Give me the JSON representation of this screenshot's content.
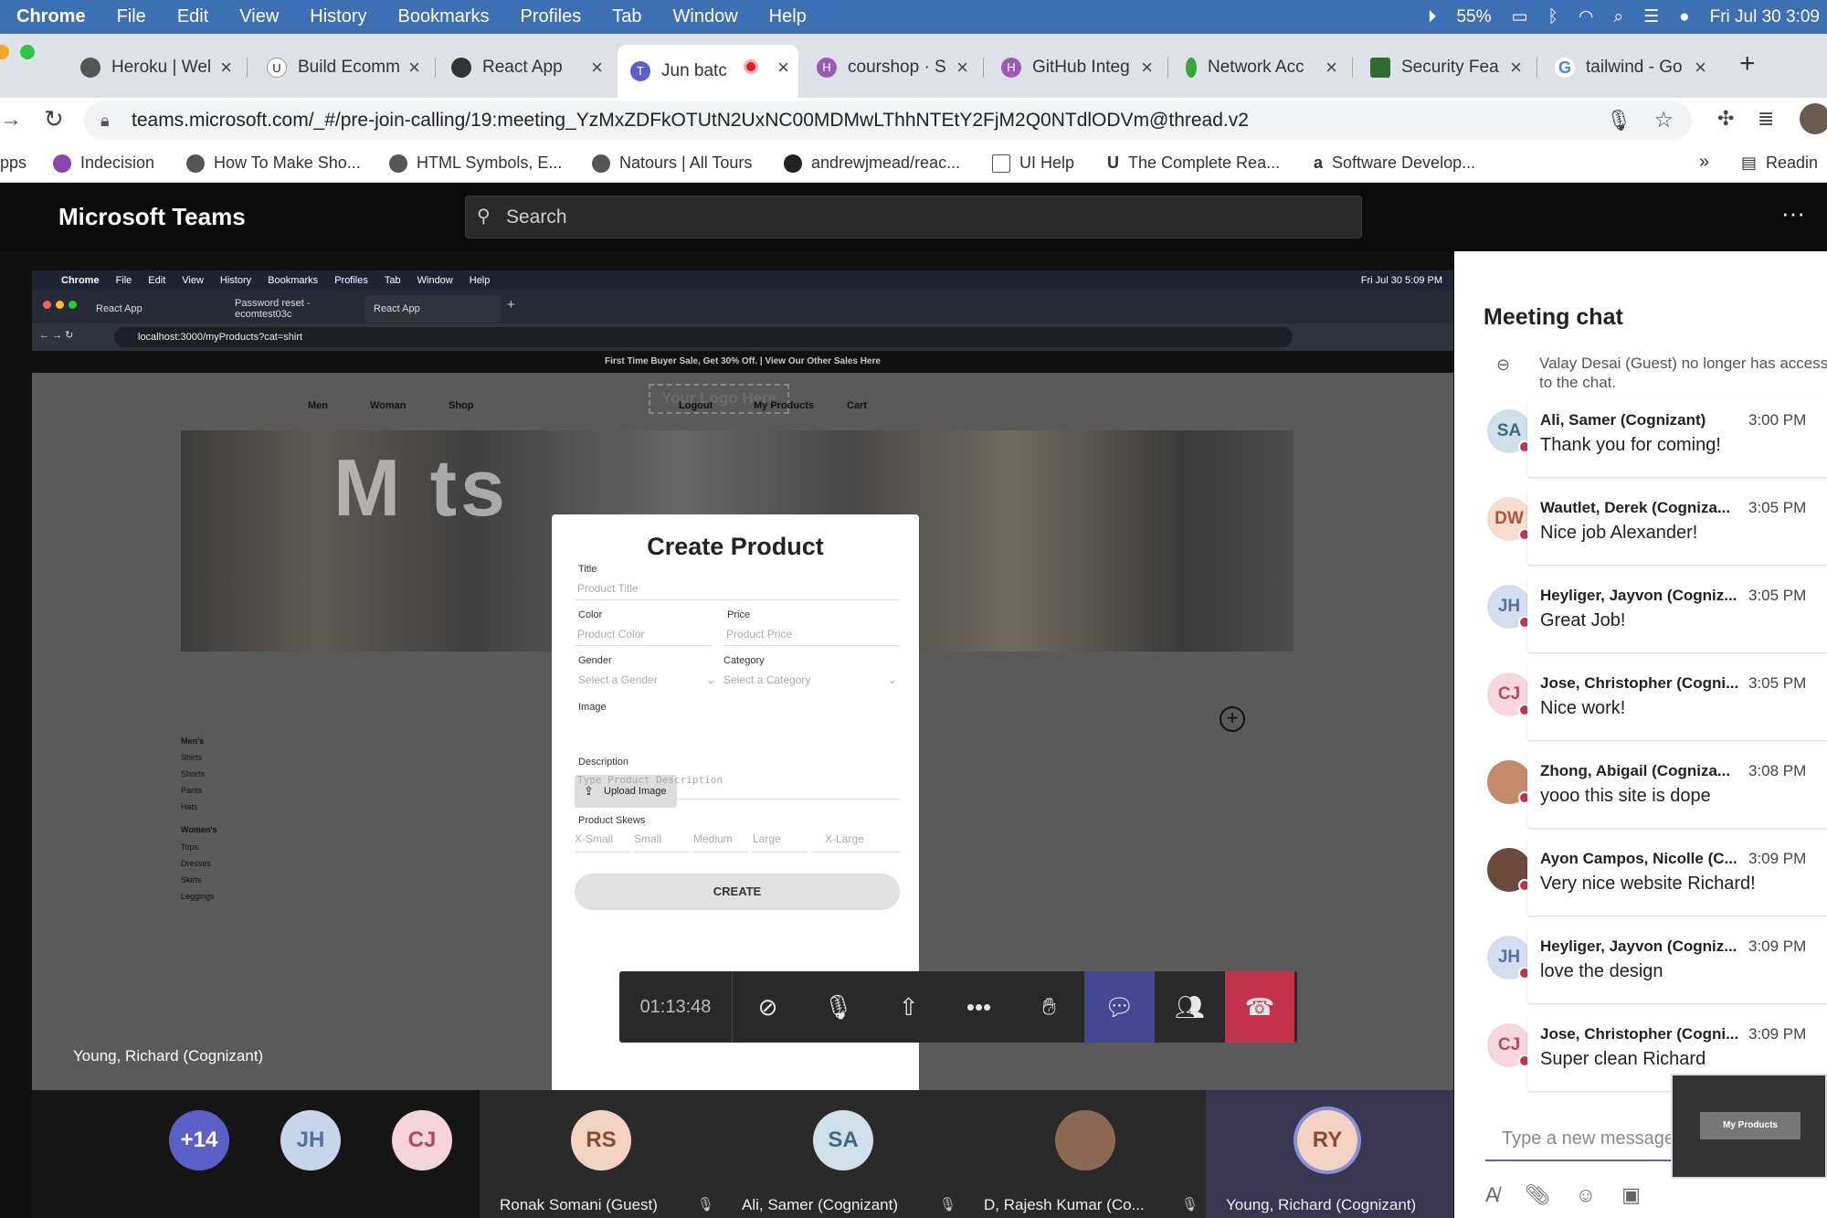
{
  "menubar": {
    "app": "Chrome",
    "items": [
      "File",
      "Edit",
      "View",
      "History",
      "Bookmarks",
      "Profiles",
      "Tab",
      "Window",
      "Help"
    ],
    "battery": "55%",
    "clock": "Fri Jul 30 3:09"
  },
  "tabs": [
    {
      "label": "Heroku | Wel"
    },
    {
      "label": "Build Ecomm"
    },
    {
      "label": "React App"
    },
    {
      "label": "Jun batc"
    },
    {
      "label": "courshop · S"
    },
    {
      "label": "GitHub Integ"
    },
    {
      "label": "Network Acc"
    },
    {
      "label": "Security Fea"
    },
    {
      "label": "tailwind - Go"
    }
  ],
  "address": {
    "url": "teams.microsoft.com/_#/pre-join-calling/19:meeting_YzMxZDFkOTUtN2UxNC00MDMwLThhNTEtY2FjM2Q0NTdlODVm@thread.v2"
  },
  "bookmarks": [
    "pps",
    "Indecision",
    "How To Make Sho...",
    "HTML Symbols, E...",
    "Natours | All Tours",
    "andrewjmead/reac...",
    "UI Help",
    "The Complete Rea...",
    "Software Develop...",
    "Readin"
  ],
  "teams": {
    "title": "Microsoft Teams",
    "search_placeholder": "Search"
  },
  "inner": {
    "menu": [
      "Chrome",
      "File",
      "Edit",
      "View",
      "History",
      "Bookmarks",
      "Profiles",
      "Tab",
      "Window",
      "Help"
    ],
    "clock": "Fri Jul 30 5:09 PM",
    "tabs": [
      "React App",
      "Password reset - ecomtest03c",
      "React App"
    ],
    "url": "localhost:3000/myProducts?cat=shirt",
    "promo": "First Time Buyer Sale, Get 30% Off. | View Our Other Sales Here",
    "nav": [
      "Men",
      "Woman",
      "Shop",
      "Logout",
      "My Products",
      "Cart"
    ],
    "logo": "Your Logo Here",
    "hero_text": "M               ts",
    "side_men": [
      "Men's",
      "Shirts",
      "Shorts",
      "Pants",
      "Hats"
    ],
    "side_women": [
      "Women's",
      "Tops",
      "Dresses",
      "Skirts",
      "Leggings"
    ]
  },
  "modal": {
    "title": "Create Product",
    "title_label": "Title",
    "title_placeholder": "Product Title",
    "color_label": "Color",
    "color_placeholder": "Product Color",
    "price_label": "Price",
    "price_placeholder": "Product Price",
    "gender_label": "Gender",
    "gender_placeholder": "Select a Gender",
    "category_label": "Category",
    "category_placeholder": "Select a Category",
    "image_label": "Image",
    "upload": "Upload Image",
    "description_label": "Description",
    "description_placeholder": "Type Product Description",
    "skews_label": "Product Skews",
    "sizes": [
      "X-Small",
      "Small",
      "Medium",
      "Large",
      "X-Large"
    ],
    "create": "CREATE"
  },
  "call": {
    "timer": "01:13:48",
    "presenter": "Young, Richard (Cognizant)"
  },
  "participants": [
    {
      "initials": "+14",
      "name": "",
      "color": "#5b5fc7"
    },
    {
      "initials": "JH",
      "name": "",
      "color": "#c7d5ea"
    },
    {
      "initials": "CJ",
      "name": "",
      "color": "#f4d3da"
    },
    {
      "initials": "RS",
      "name": "Ronak Somani (Guest)",
      "color": "#f3d2c1"
    },
    {
      "initials": "SA",
      "name": "Ali, Samer (Cognizant)",
      "color": "#cfe0e8"
    },
    {
      "initials": "",
      "name": "D, Rajesh Kumar (Co...",
      "color": "#8a6a55"
    },
    {
      "initials": "RY",
      "name": "Young, Richard (Cognizant)",
      "color": "#f3d2c1"
    }
  ],
  "chat": {
    "title": "Meeting chat",
    "system": "Valay Desai (Guest) no longer has access to the chat.",
    "messages": [
      {
        "initials": "SA",
        "color": "#cfe0e8",
        "name": "Ali, Samer (Cognizant)",
        "time": "3:00 PM",
        "text": "Thank you for coming!"
      },
      {
        "initials": "DW",
        "color": "#f8dccd",
        "name": "Wautlet, Derek (Cogniza...",
        "time": "3:05 PM",
        "text": "Nice job Alexander!"
      },
      {
        "initials": "JH",
        "color": "#d5def0",
        "name": "Heyliger, Jayvon (Cogniz...",
        "time": "3:05 PM",
        "text": "Great Job!"
      },
      {
        "initials": "CJ",
        "color": "#f7d6df",
        "name": "Jose, Christopher (Cogni...",
        "time": "3:05 PM",
        "text": "Nice work!"
      },
      {
        "initials": "",
        "color": "#c58a6a",
        "name": "Zhong, Abigail (Cogniza...",
        "time": "3:08 PM",
        "text": "yooo this site is dope"
      },
      {
        "initials": "",
        "color": "#6a4a3a",
        "name": "Ayon Campos, Nicolle (C...",
        "time": "3:09 PM",
        "text": "Very nice website Richard!"
      },
      {
        "initials": "JH",
        "color": "#d5def0",
        "name": "Heyliger, Jayvon (Cogniz...",
        "time": "3:09 PM",
        "text": "love the design"
      },
      {
        "initials": "CJ",
        "color": "#f7d6df",
        "name": "Jose, Christopher (Cogni...",
        "time": "3:09 PM",
        "text": "Super clean Richard"
      }
    ],
    "compose_placeholder": "Type a new message",
    "thumb_text": "My Products"
  }
}
